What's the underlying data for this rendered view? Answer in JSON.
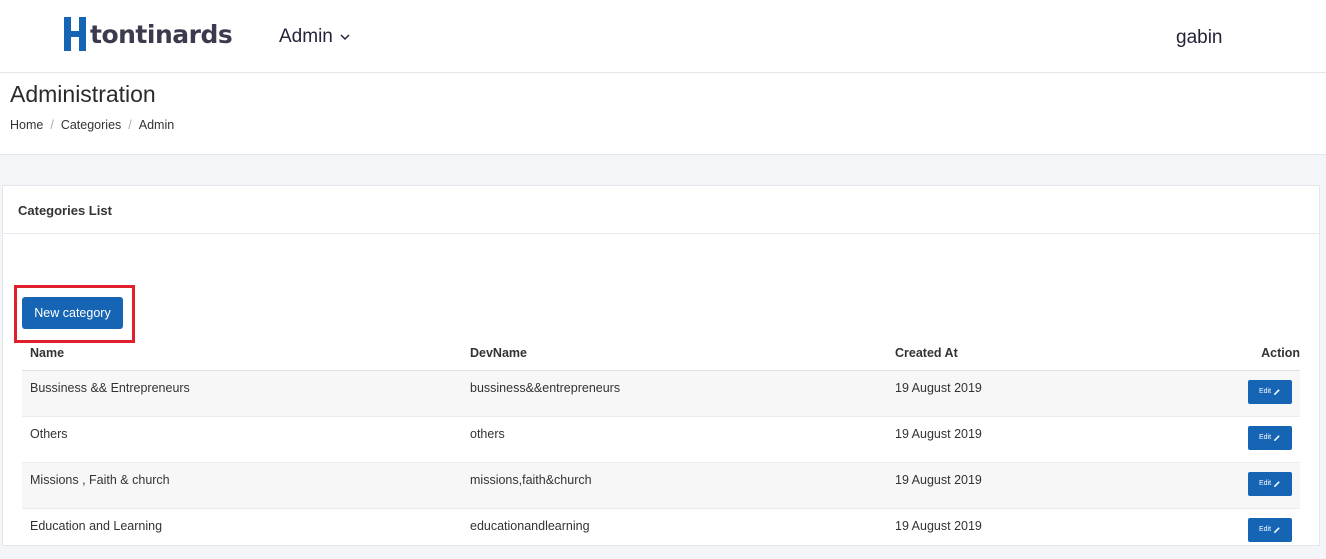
{
  "brand": {
    "name": "tontinards",
    "mark_color": "#1565b4"
  },
  "nav": {
    "admin_label": "Admin",
    "user_name": "gabin"
  },
  "header": {
    "title": "Administration",
    "breadcrumb": [
      "Home",
      "Categories",
      "Admin"
    ]
  },
  "card": {
    "title": "Categories List",
    "new_button_label": "New category",
    "columns": [
      "Name",
      "DevName",
      "Created At",
      "Action"
    ],
    "edit_label": "Edit",
    "rows": [
      {
        "name": "Bussiness && Entrepreneurs",
        "dev_name": "bussiness&&entrepreneurs",
        "created_at": "19 August 2019"
      },
      {
        "name": "Others",
        "dev_name": "others",
        "created_at": "19 August 2019"
      },
      {
        "name": "Missions , Faith & church",
        "dev_name": "missions,faith&church",
        "created_at": "19 August 2019"
      },
      {
        "name": "Education and Learning",
        "dev_name": "educationandlearning",
        "created_at": "19 August 2019"
      }
    ]
  },
  "colors": {
    "primary": "#1565b4",
    "highlight": "#e0202a"
  }
}
